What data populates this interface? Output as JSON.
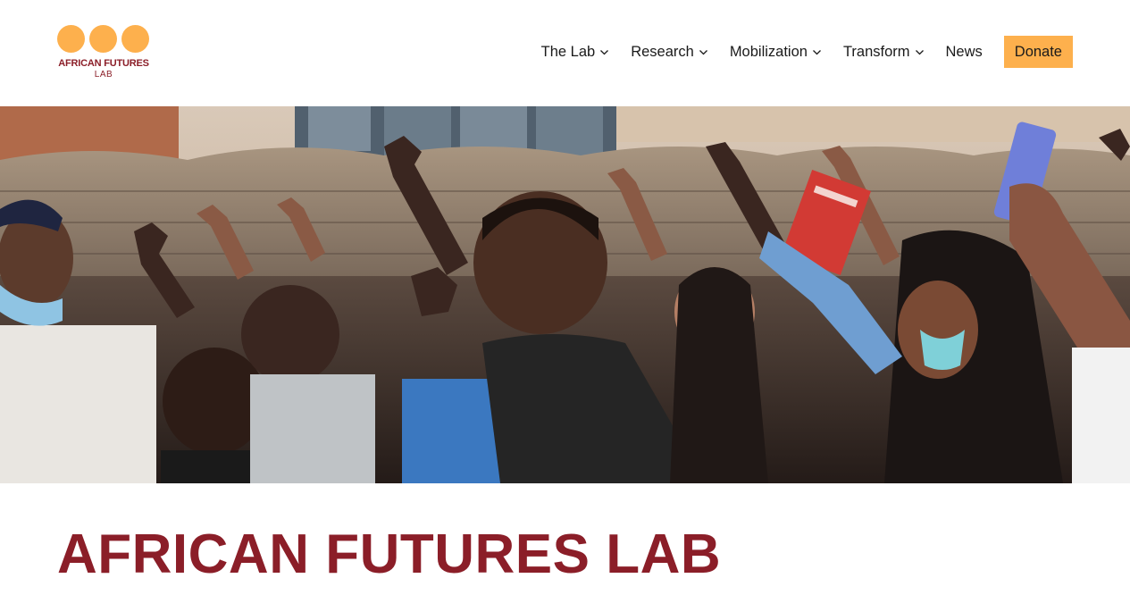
{
  "brand": {
    "name": "AFRICAN FUTURES",
    "sub": "LAB",
    "dot_color": "#FDB04D",
    "text_color": "#8B1E28"
  },
  "nav": {
    "items": [
      {
        "label": "The Lab",
        "has_dropdown": true
      },
      {
        "label": "Research",
        "has_dropdown": true
      },
      {
        "label": "Mobilization",
        "has_dropdown": true
      },
      {
        "label": "Transform",
        "has_dropdown": true
      },
      {
        "label": "News",
        "has_dropdown": false
      }
    ],
    "donate_label": "Donate",
    "donate_color": "#FDB04D"
  },
  "hero": {
    "icon": "protest-crowd-photo"
  },
  "page": {
    "title": "AFRICAN FUTURES LAB",
    "title_color": "#8B1E28"
  }
}
